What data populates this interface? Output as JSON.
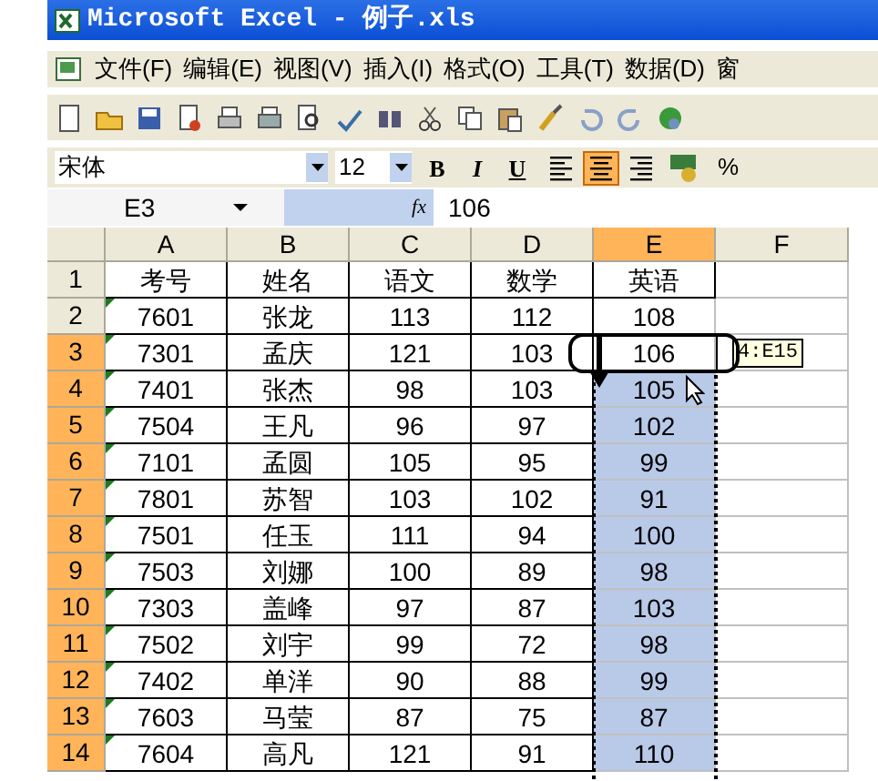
{
  "window": {
    "title": "Microsoft Excel - 例子.xls"
  },
  "menu": [
    "文件(F)",
    "编辑(E)",
    "视图(V)",
    "插入(I)",
    "格式(O)",
    "工具(T)",
    "数据(D)",
    "窗"
  ],
  "format_bar": {
    "font": "宋体",
    "size": "12",
    "buttons": [
      {
        "label": "B",
        "kind": "bold"
      },
      {
        "label": "I",
        "kind": "italic"
      },
      {
        "label": "U",
        "kind": "underline"
      }
    ],
    "align": [
      {
        "kind": "left",
        "selected": false
      },
      {
        "kind": "center",
        "selected": true
      },
      {
        "kind": "right",
        "selected": false
      }
    ],
    "percent": "%"
  },
  "formula_bar": {
    "name_box": "E3",
    "fx": "fx",
    "value": "106"
  },
  "sheet": {
    "columns": [
      {
        "label": "A",
        "selected": false
      },
      {
        "label": "B",
        "selected": false
      },
      {
        "label": "C",
        "selected": false
      },
      {
        "label": "D",
        "selected": false
      },
      {
        "label": "E",
        "selected": true
      },
      {
        "label": "F",
        "selected": false
      }
    ],
    "rows": [
      {
        "number": "1",
        "selected": false,
        "text_mark": false,
        "in_range": false,
        "cells": [
          "考号",
          "姓名",
          "语文",
          "数学",
          "英语"
        ]
      },
      {
        "number": "2",
        "selected": false,
        "text_mark": true,
        "in_range": false,
        "cells": [
          "7601",
          "张龙",
          "113",
          "112",
          "108"
        ]
      },
      {
        "number": "3",
        "selected": true,
        "text_mark": true,
        "in_range": false,
        "cells": [
          "7301",
          "孟庆",
          "121",
          "103",
          "106"
        ]
      },
      {
        "number": "4",
        "selected": true,
        "text_mark": true,
        "in_range": true,
        "cells": [
          "7401",
          "张杰",
          "98",
          "103",
          "105"
        ]
      },
      {
        "number": "5",
        "selected": true,
        "text_mark": true,
        "in_range": true,
        "cells": [
          "7504",
          "王凡",
          "96",
          "97",
          "102"
        ]
      },
      {
        "number": "6",
        "selected": true,
        "text_mark": true,
        "in_range": true,
        "cells": [
          "7101",
          "孟圆",
          "105",
          "95",
          "99"
        ]
      },
      {
        "number": "7",
        "selected": true,
        "text_mark": true,
        "in_range": true,
        "cells": [
          "7801",
          "苏智",
          "103",
          "102",
          "91"
        ]
      },
      {
        "number": "8",
        "selected": true,
        "text_mark": true,
        "in_range": true,
        "cells": [
          "7501",
          "任玉",
          "111",
          "94",
          "100"
        ]
      },
      {
        "number": "9",
        "selected": true,
        "text_mark": true,
        "in_range": true,
        "cells": [
          "7503",
          "刘娜",
          "100",
          "89",
          "98"
        ]
      },
      {
        "number": "10",
        "selected": true,
        "text_mark": true,
        "in_range": true,
        "cells": [
          "7303",
          "盖峰",
          "97",
          "87",
          "103"
        ]
      },
      {
        "number": "11",
        "selected": true,
        "text_mark": true,
        "in_range": true,
        "cells": [
          "7502",
          "刘宇",
          "99",
          "72",
          "98"
        ]
      },
      {
        "number": "12",
        "selected": true,
        "text_mark": true,
        "in_range": true,
        "cells": [
          "7402",
          "单洋",
          "90",
          "88",
          "99"
        ]
      },
      {
        "number": "13",
        "selected": true,
        "text_mark": true,
        "in_range": true,
        "cells": [
          "7603",
          "马莹",
          "87",
          "75",
          "87"
        ]
      },
      {
        "number": "14",
        "selected": true,
        "text_mark": true,
        "in_range": true,
        "cells": [
          "7604",
          "高凡",
          "121",
          "91",
          "110"
        ]
      }
    ],
    "range_tip": "4:E15"
  }
}
